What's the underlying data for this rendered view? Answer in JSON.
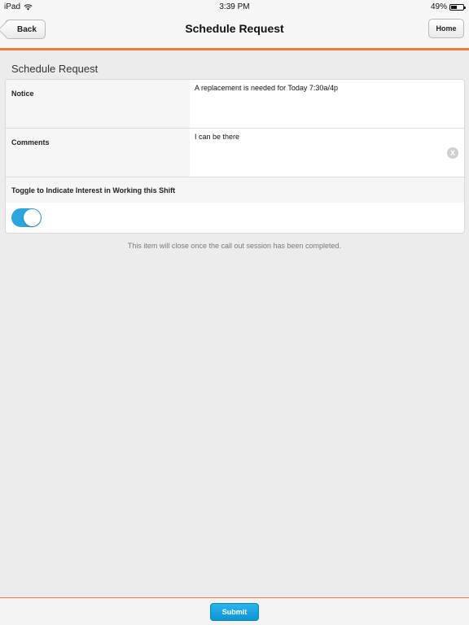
{
  "status_bar": {
    "device": "iPad",
    "time": "3:39 PM",
    "battery": "49%",
    "battery_level": 0.49,
    "wifi_icon": "wifi-icon",
    "battery_icon": "battery-icon"
  },
  "nav": {
    "back_label": "Back",
    "title": "Schedule Request",
    "home_label": "Home"
  },
  "section": {
    "title": "Schedule Request"
  },
  "form": {
    "notice_label": "Notice",
    "notice_value": "A replacement is needed for Today 7:30a/4p",
    "comments_label": "Comments",
    "comments_value": "I can be there",
    "clear_icon": "clear-icon",
    "clear_glyph": "X",
    "toggle_label": "Toggle to Indicate Interest in Working this Shift",
    "toggle_on": true
  },
  "info_note": "This item will close once the call out session has been completed.",
  "bottom": {
    "submit_label": "Submit"
  },
  "colors": {
    "accent": "#ef7a3c",
    "toggle": "#2ba5df",
    "submit": "#0d95d3"
  }
}
